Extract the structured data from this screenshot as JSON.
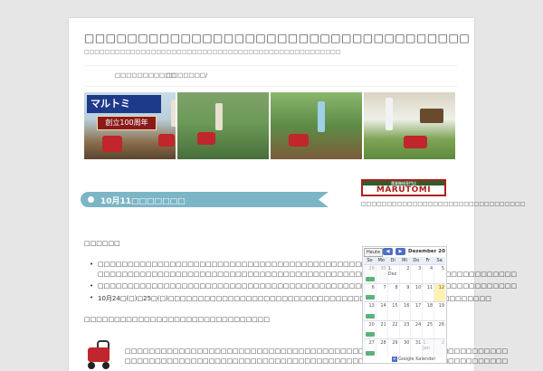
{
  "site": {
    "title": "□□□□□□□□□□□□□□□□□□□□□□□□□□□□□□□□□□□□",
    "description": "□□□□□□□□□□□□□□□□□□□□□□□□□□□□□□□□□□□□□□□□□□□□□□□□□□"
  },
  "nav": {
    "items": [
      "□□□□□□□□□□□",
      "□□□□□□□/"
    ]
  },
  "banner": {
    "logo_text": "マルトミ",
    "anniversary_text": "創立100周年"
  },
  "post": {
    "title": "10月11□□□□□□□",
    "lines": [
      "□□□□□□",
      "□□□□□□□□□□□□□□□□□□□□□□□□□□□□□□□□□□□□□□□□□□□□□□",
      "□□□□□□□□□□□□□□□□□□□□□□□□□□□□□□□□□□□□□□□□□□□□□□□□□□□□□□□□□□□□□□□□□□□□□□",
      "□□□□□□□□□□□□□□□□□□□□□□□□□□□□□□□□□□□□□□□□□□□□□□□□□□□□□□□□□□□□□□□□□□□□□□",
      "10月24□(□)□25□(□)□□□□□□□□□□□□□□□□□□□□□□□□□□□□□□□□□□□□□□□□□□□□□□□□□□□□□□",
      "□□□□□□□□□□□□□□□□□□□□□□□□□□□□□□□",
      "□□□□□□□□□□□□□□□□□□□□□□□□□□□□□□□□□□□□□□□□□□□□□□□□□□□□□□□□□□□□□□□□",
      "□□□□□□□□□□□□□□□□□□□□□□□□□□□□□□□□□□□□□□□□□□□□□□□□□□□□□□□□□□□□□□□□"
    ]
  },
  "sidebar": {
    "logo_top": "農業機械専門店",
    "logo_name": "MARUTOMI",
    "text": "□□□□□□□□□□□□□□□□□□□□□□□□□□□□□□□□"
  },
  "calendar": {
    "today_label": "Heute",
    "prev_label": "◀",
    "next_label": "▶",
    "month_label": "Dezember 20",
    "dow": [
      "So",
      "Mo",
      "Di",
      "Mi",
      "Do",
      "Fr",
      "Sa"
    ],
    "weeks": [
      [
        "29",
        "30",
        "1. Dez",
        "2",
        "3",
        "4",
        "5"
      ],
      [
        "6",
        "7",
        "8",
        "9",
        "10",
        "11",
        "12"
      ],
      [
        "13",
        "14",
        "15",
        "16",
        "17",
        "18",
        "19"
      ],
      [
        "20",
        "21",
        "22",
        "23",
        "24",
        "25",
        "26"
      ],
      [
        "27",
        "28",
        "29",
        "30",
        "31",
        "1. Jan",
        "2"
      ]
    ],
    "footer": "Google Kalender"
  },
  "colors": {
    "accent": "#7cb5c6",
    "brand_red": "#b11d1d",
    "calendar_blue": "#4d6fc4",
    "event_green": "#5db27a"
  }
}
